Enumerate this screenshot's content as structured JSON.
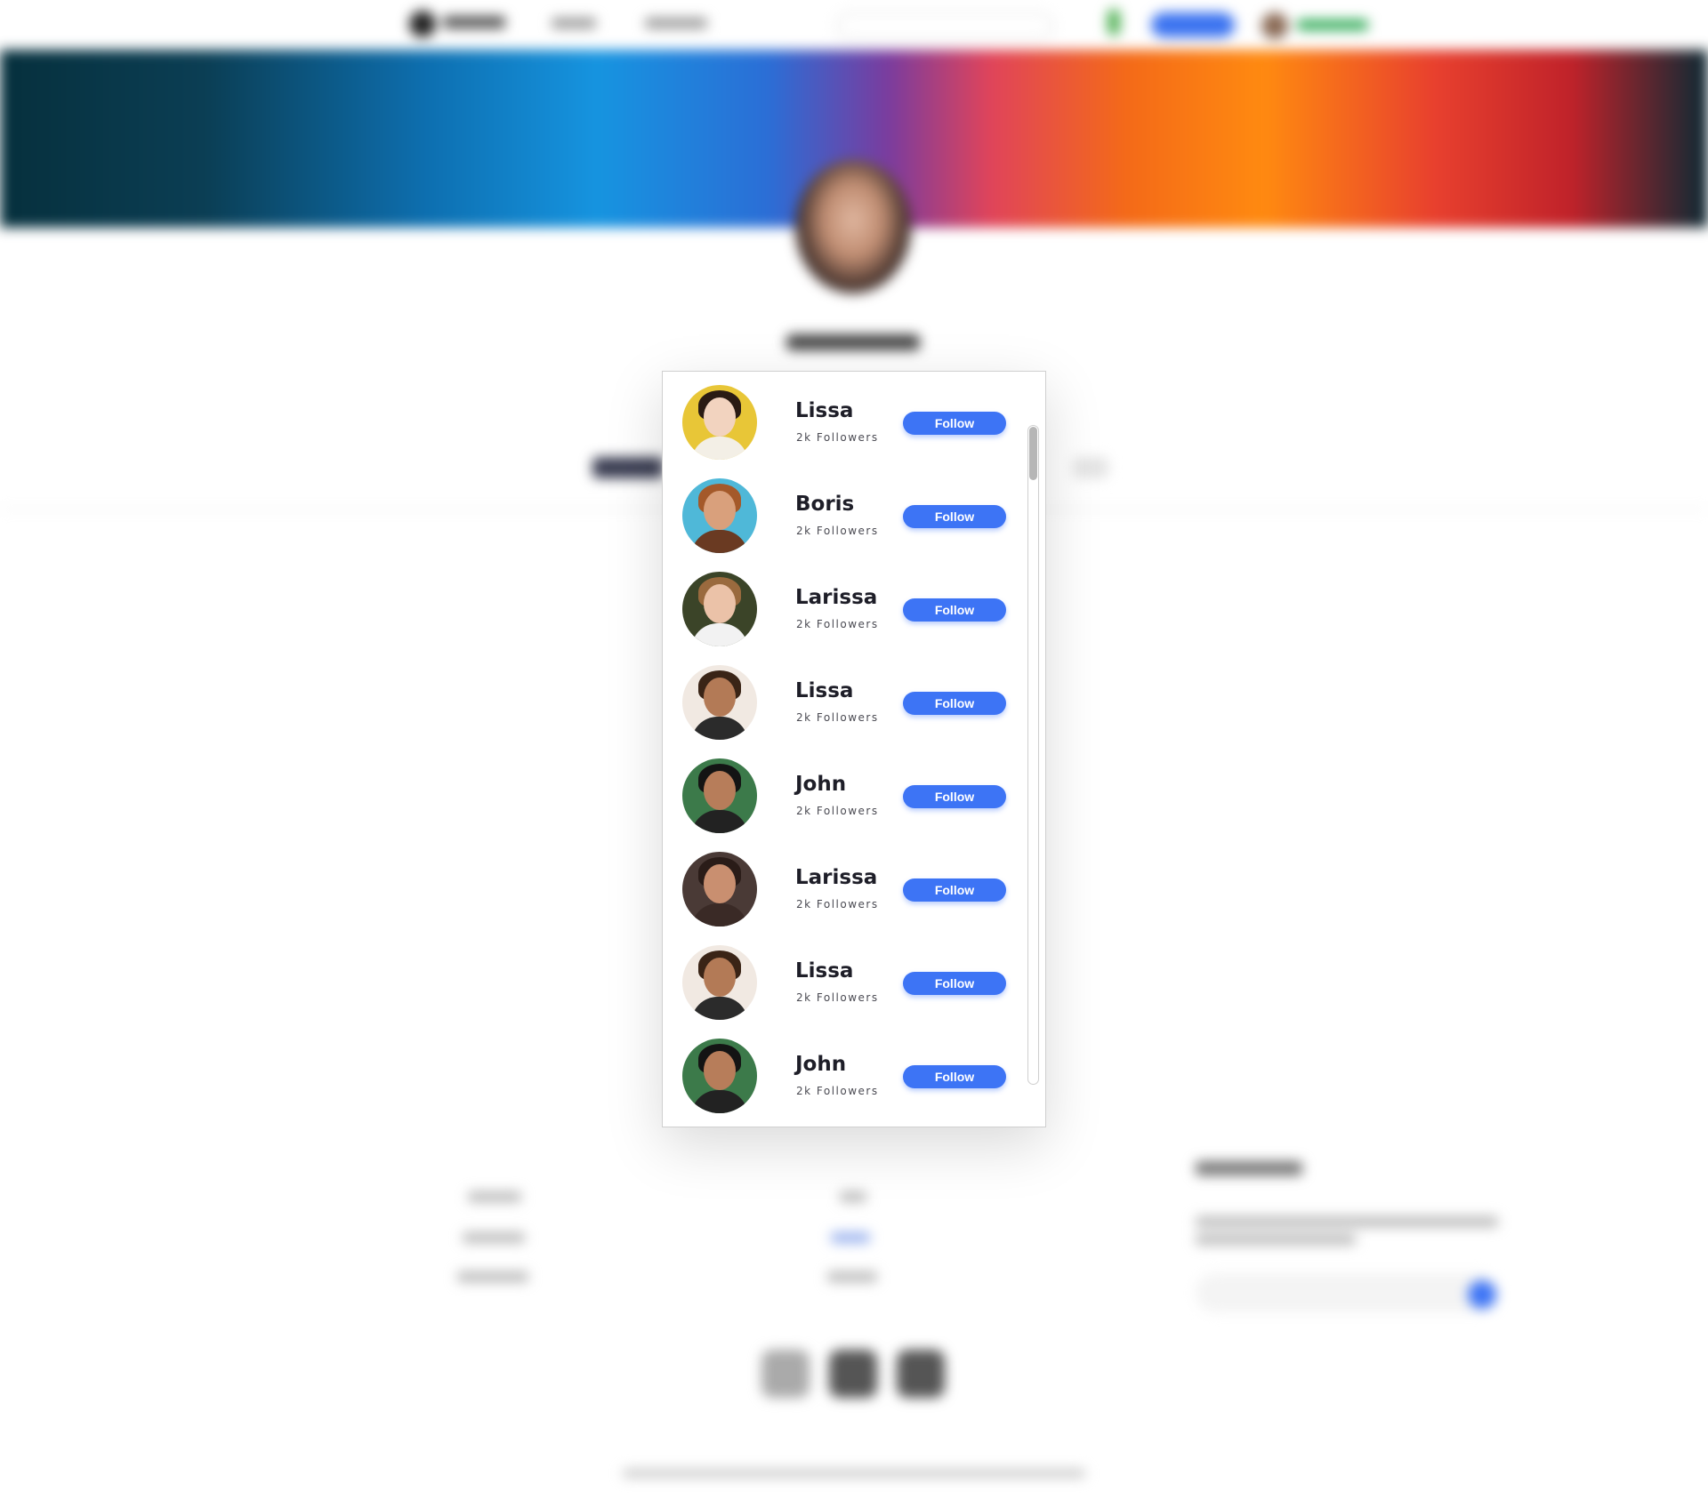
{
  "followers_modal": {
    "items": [
      {
        "name": "Lissa",
        "followers": "2k Followers",
        "follow_label": "Follow",
        "avatar_bg": "#e8c637",
        "skin": "#f2d3bf",
        "hair": "#2a1b14",
        "shirt": "#f3efe6"
      },
      {
        "name": "Boris",
        "followers": "2k Followers",
        "follow_label": "Follow",
        "avatar_bg": "#4fb8d8",
        "skin": "#d9a07c",
        "hair": "#a4592a",
        "shirt": "#6a3a22"
      },
      {
        "name": "Larissa",
        "followers": "2k Followers",
        "follow_label": "Follow",
        "avatar_bg": "#3b4428",
        "skin": "#ebc2a8",
        "hair": "#9a6a3e",
        "shirt": "#f2f2f2"
      },
      {
        "name": "Lissa",
        "followers": "2k Followers",
        "follow_label": "Follow",
        "avatar_bg": "#f1e9e2",
        "skin": "#b37a56",
        "hair": "#3a2416",
        "shirt": "#2b2b2b"
      },
      {
        "name": "John",
        "followers": "2k Followers",
        "follow_label": "Follow",
        "avatar_bg": "#3c7a4a",
        "skin": "#b77d5a",
        "hair": "#141414",
        "shirt": "#222222"
      },
      {
        "name": "Larissa",
        "followers": "2k Followers",
        "follow_label": "Follow",
        "avatar_bg": "#4a3a36",
        "skin": "#c98f70",
        "hair": "#2a1c18",
        "shirt": "#3a2a26"
      },
      {
        "name": "Lissa",
        "followers": "2k Followers",
        "follow_label": "Follow",
        "avatar_bg": "#f1e9e2",
        "skin": "#b37a56",
        "hair": "#3a2416",
        "shirt": "#2b2b2b"
      },
      {
        "name": "John",
        "followers": "2k Followers",
        "follow_label": "Follow",
        "avatar_bg": "#3c7a4a",
        "skin": "#b77d5a",
        "hair": "#141414",
        "shirt": "#222222"
      }
    ],
    "accent_color": "#3d74f5"
  }
}
